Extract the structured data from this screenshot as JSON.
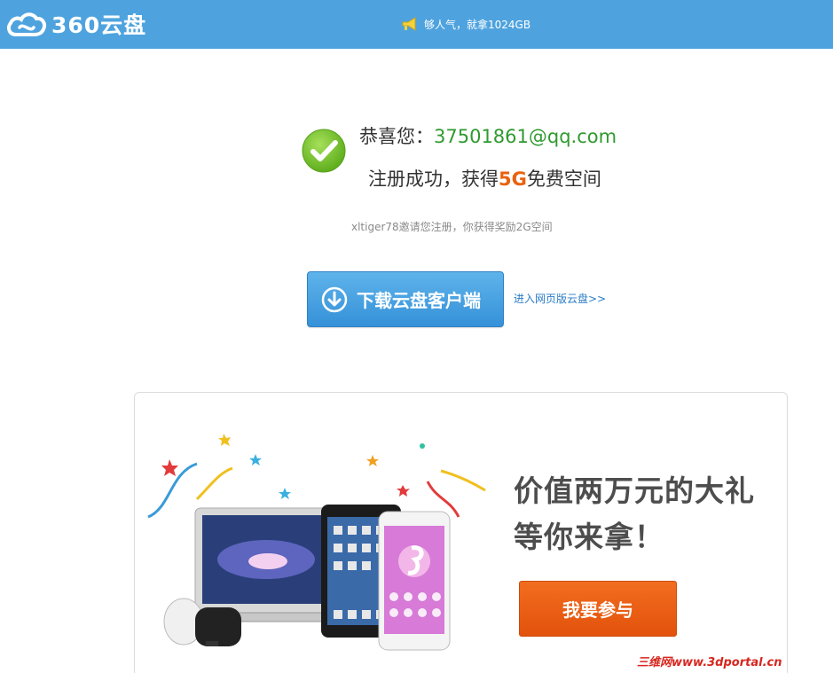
{
  "header": {
    "logo_text": "360云盘",
    "promo_text": "够人气，就拿1024GB"
  },
  "success": {
    "congrats_prefix": "恭喜您：",
    "email": "37501861@qq.com",
    "reg_prefix": "注册成功，获得",
    "reg_gb": "5G",
    "reg_suffix": "免费空间",
    "invite_text": "xltiger78邀请您注册，你获得奖励2G空间"
  },
  "actions": {
    "download_label": "下载云盘客户端",
    "web_link": "进入网页版云盘>>"
  },
  "banner": {
    "slogan_line1": "价值两万元的大礼",
    "slogan_line2": "等你来拿！",
    "join_label": "我要参与"
  },
  "watermark": "三维网www.3dportal.cn",
  "colors": {
    "header_bg": "#4ea3df",
    "email_green": "#2f9a2f",
    "highlight_orange": "#e8620f",
    "download_blue": "#3591d8",
    "join_orange": "#e2520c"
  }
}
